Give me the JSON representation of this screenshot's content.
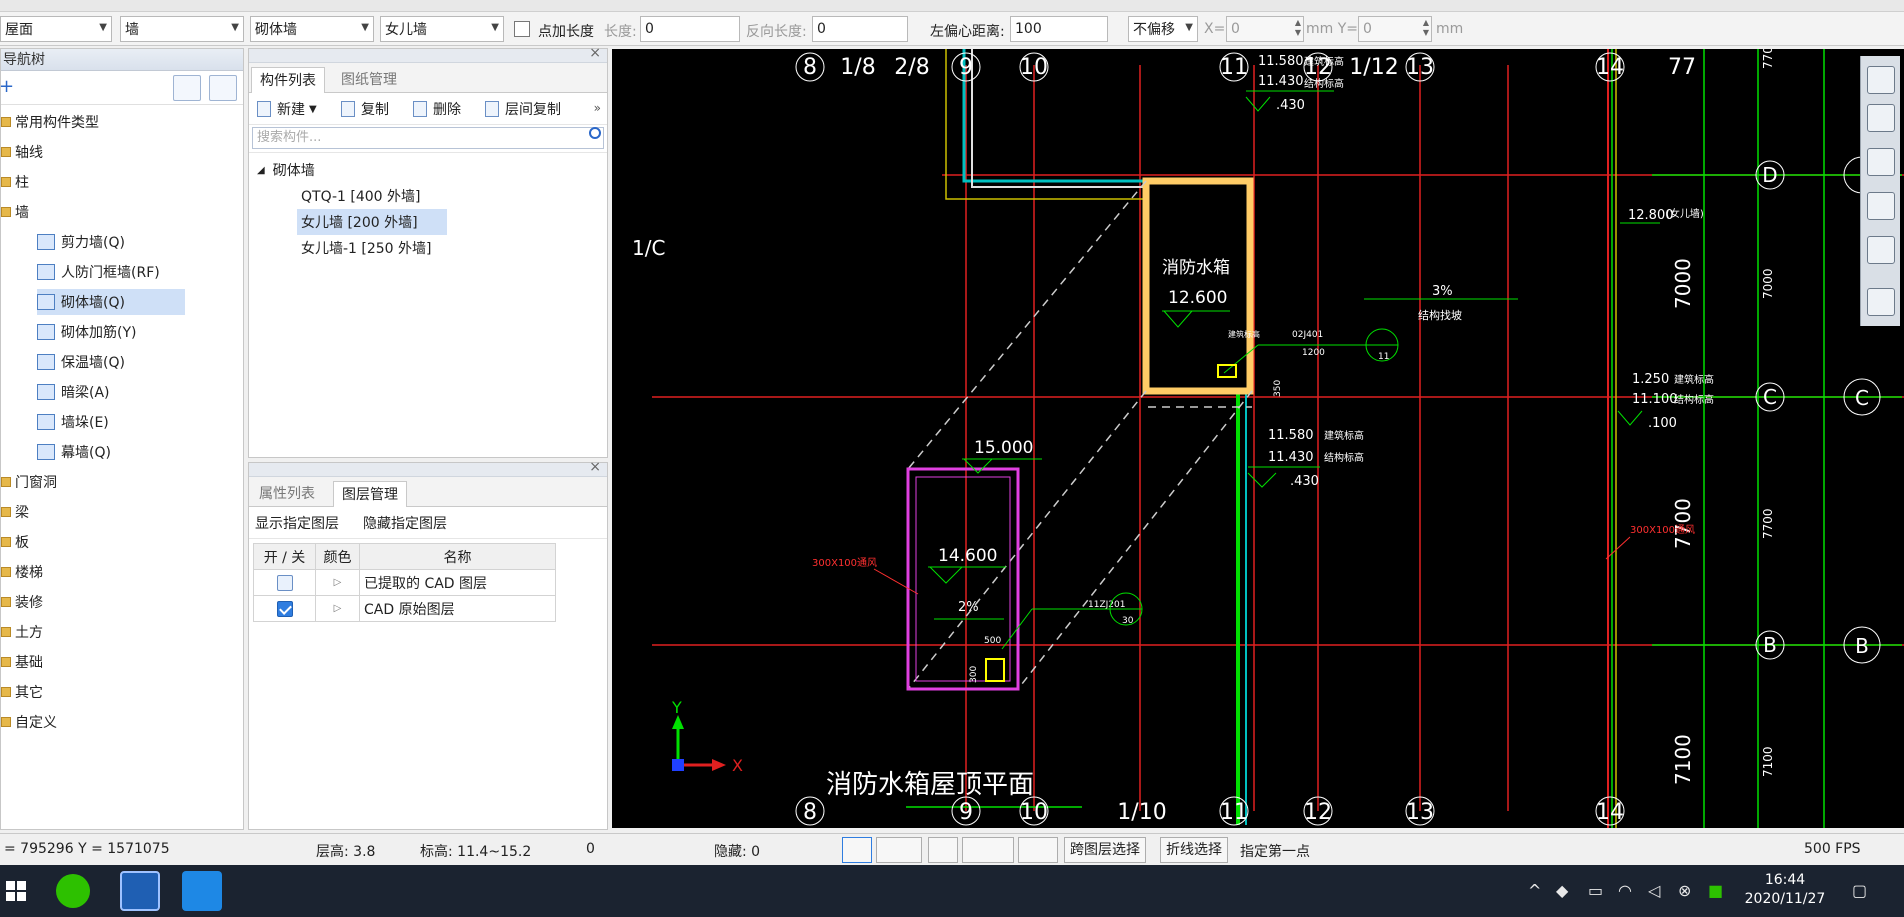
{
  "toolbar": {
    "floor_select": "屋面",
    "category_select": "墙",
    "type_select": "砌体墙",
    "component_select": "女儿墙",
    "add_length_label": "点加长度",
    "length_label": "长度:",
    "length_value": "0",
    "reverse_length_label": "反向长度:",
    "reverse_length_value": "0",
    "left_offset_label": "左偏心距离:",
    "left_offset_value": "100",
    "offset_mode": "不偏移",
    "x_label": "X=",
    "x_value": "0",
    "y_label": "mm Y=",
    "y_value": "0",
    "mm_label": "mm"
  },
  "nav_tree": {
    "title": "导航树",
    "items": [
      {
        "label": "常用构件类型"
      },
      {
        "label": "轴线"
      },
      {
        "label": "柱"
      },
      {
        "label": "墙"
      },
      {
        "label": "剪力墙(Q)"
      },
      {
        "label": "人防门框墙(RF)"
      },
      {
        "label": "砌体墙(Q)"
      },
      {
        "label": "砌体加筋(Y)"
      },
      {
        "label": "保温墙(Q)"
      },
      {
        "label": "暗梁(A)"
      },
      {
        "label": "墙垛(E)"
      },
      {
        "label": "幕墙(Q)"
      },
      {
        "label": "门窗洞"
      },
      {
        "label": "梁"
      },
      {
        "label": "板"
      },
      {
        "label": "楼梯"
      },
      {
        "label": "装修"
      },
      {
        "label": "土方"
      },
      {
        "label": "基础"
      },
      {
        "label": "其它"
      },
      {
        "label": "自定义"
      }
    ]
  },
  "component_panel": {
    "tab_list": "构件列表",
    "tab_drawing": "图纸管理",
    "new": "新建",
    "copy": "复制",
    "delete": "删除",
    "floor_copy": "层间复制",
    "search_placeholder": "搜索构件...",
    "group": "砌体墙",
    "items": [
      "QTQ-1 [400 外墙]",
      "女儿墙 [200 外墙]",
      "女儿墙-1 [250 外墙]"
    ]
  },
  "layer_panel": {
    "tab_props": "属性列表",
    "tab_layers": "图层管理",
    "show_layer": "显示指定图层",
    "hide_layer": "隐藏指定图层",
    "col_toggle": "开 / 关",
    "col_color": "颜色",
    "col_name": "名称",
    "rows": [
      {
        "name": "已提取的 CAD 图层"
      },
      {
        "name": "CAD 原始图层"
      }
    ]
  },
  "cad": {
    "top_axes": [
      "8",
      "1/8",
      "2/8",
      "9",
      "10",
      "11",
      "12",
      "1/12",
      "13",
      "14",
      "77"
    ],
    "bottom_axes": [
      "8",
      "9",
      "10",
      "1/10",
      "11",
      "12",
      "13",
      "14"
    ],
    "right_axes": [
      "D",
      "C",
      "C",
      "B",
      "B"
    ],
    "left_axis": "1/C",
    "dims": [
      "7000",
      "7700",
      "7100"
    ],
    "small_dims": [
      "770",
      "7000",
      "7700",
      "7100"
    ],
    "tank_label": "消防水箱",
    "elev_12600": "12.600",
    "elev_15000": "15.000",
    "elev_14600": "14.600",
    "slope_2": "2%",
    "slope_3": "3%",
    "slope_note": "结构找坡",
    "elev_11580a": "11.580",
    "elev_11430a": "11.430",
    "elev_430a": ".430",
    "note_jzbg": "建筑标高",
    "note_jgbg": "结构标高",
    "elev_11580b": "11.580",
    "elev_11430b": "11.430",
    "elev_430b": ".430",
    "elev_12800": "12.800",
    "note_parapet": "(女儿墙)",
    "elev_11250": "1.250",
    "elev_11100": "11.100",
    "elev_100": ".100",
    "opening_left": "300X100通风",
    "opening_right": "300X100通风",
    "detail_code": "02J401",
    "detail_code2": "11ZJ201",
    "detail_num": "1200",
    "detail_bubble1": "11",
    "detail_bubble2": "30",
    "dim_500": "500",
    "dim_300": "300",
    "dim_350": "350",
    "drawing_title": "消防水箱屋顶平面",
    "ucs_x": "X",
    "ucs_y": "Y",
    "colors": {
      "axis": "#ff0000",
      "wall": "#ffcc66",
      "grid_green": "#00ff00",
      "magenta": "#ff00ff",
      "text": "#ffffff"
    }
  },
  "status": {
    "coords": "= 795296 Y = 1571075",
    "floor_height": "层高:  3.8",
    "elevation": "标高:  11.4~15.2",
    "zero": "0",
    "hidden": "隐藏:  0",
    "cross_layer": "跨图层选择",
    "polyline": "折线选择",
    "prompt": "指定第一点",
    "fps": "500 FPS"
  },
  "taskbar": {
    "time": "16:44",
    "date": "2020/11/27"
  }
}
